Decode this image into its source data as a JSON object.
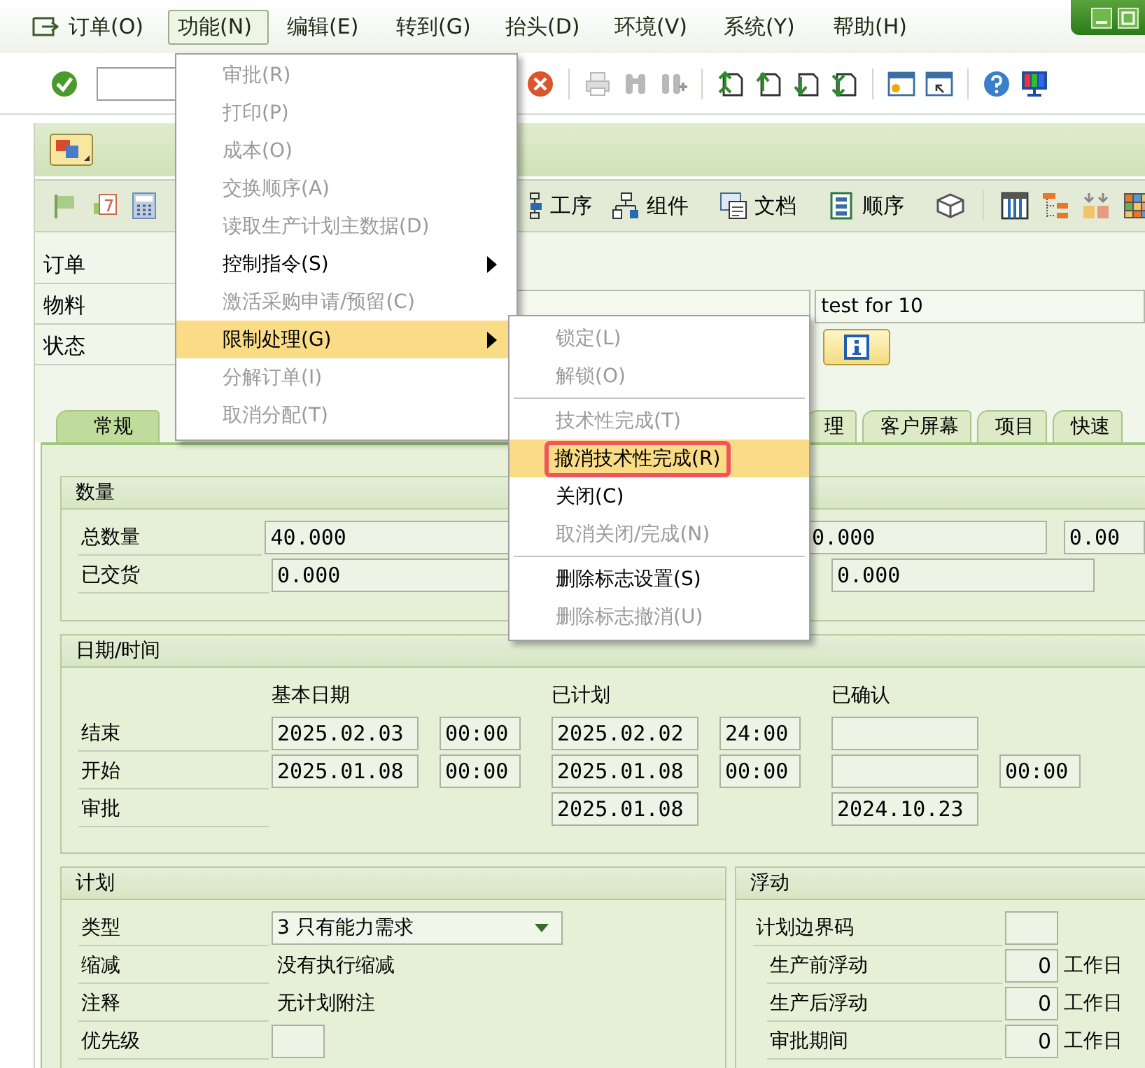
{
  "menu_bar": [
    {
      "label": "订单(O)",
      "selected": false
    },
    {
      "label": "功能(N)",
      "selected": true
    },
    {
      "label": "编辑(E)",
      "selected": false
    },
    {
      "label": "转到(G)",
      "selected": false
    },
    {
      "label": "抬头(D)",
      "selected": false
    },
    {
      "label": "环境(V)",
      "selected": false
    },
    {
      "label": "系统(Y)",
      "selected": false
    },
    {
      "label": "帮助(H)",
      "selected": false
    }
  ],
  "app_toolbar": [
    {
      "label": "工序"
    },
    {
      "label": "组件"
    },
    {
      "label": "文档"
    },
    {
      "label": "顺序"
    }
  ],
  "header": [
    {
      "label": "订单"
    },
    {
      "label": "物料",
      "description": "test for 10"
    },
    {
      "label": "状态"
    }
  ],
  "tabs": [
    {
      "label": "常规",
      "selected": true
    },
    {
      "label": "理",
      "selected": false
    },
    {
      "label": "客户屏幕",
      "selected": false
    },
    {
      "label": "项目",
      "selected": false
    },
    {
      "label": "快速",
      "selected": false
    }
  ],
  "quantities": {
    "title": "数量",
    "rows": [
      {
        "label": "总数量",
        "values": [
          "40.000",
          "0.000",
          "0.00"
        ]
      },
      {
        "label": "已交货",
        "values": [
          "0.000",
          "0.000"
        ]
      }
    ]
  },
  "dates": {
    "title": "日期/时间",
    "columns": [
      "基本日期",
      "",
      "已计划",
      "",
      "已确认"
    ],
    "rows": [
      {
        "label": "结束",
        "cells": [
          {
            "kind": "date",
            "value": "2025.02.03"
          },
          {
            "kind": "time",
            "value": "00:00"
          },
          {
            "kind": "date",
            "value": "2025.02.02"
          },
          {
            "kind": "time",
            "value": "24:00"
          },
          {
            "kind": "date"
          },
          {
            "kind": "gap"
          }
        ]
      },
      {
        "label": "开始",
        "cells": [
          {
            "kind": "date",
            "value": "2025.01.08"
          },
          {
            "kind": "time",
            "value": "00:00"
          },
          {
            "kind": "date",
            "value": "2025.01.08"
          },
          {
            "kind": "time",
            "value": "00:00"
          },
          {
            "kind": "date"
          },
          {
            "kind": "time",
            "value": "00:00"
          }
        ]
      },
      {
        "label": "审批",
        "cells": [
          {
            "kind": "gap"
          },
          {
            "kind": "gap"
          },
          {
            "kind": "date",
            "value": "2025.01.08"
          },
          {
            "kind": "gap"
          },
          {
            "kind": "date",
            "value": "2024.10.23"
          },
          {
            "kind": "gap"
          }
        ]
      }
    ]
  },
  "planning": {
    "title": "计划",
    "rows": [
      {
        "label": "类型",
        "kind": "dropdown",
        "value": "3 只有能力需求"
      },
      {
        "label": "缩减",
        "kind": "text",
        "value": "没有执行缩减"
      },
      {
        "label": "注释",
        "kind": "text",
        "value": "无计划附注"
      },
      {
        "label": "优先级",
        "kind": "field"
      }
    ]
  },
  "float": {
    "title": "浮动",
    "rows": [
      {
        "label": "计划边界码",
        "kind": "field"
      },
      {
        "label": "生产前浮动",
        "kind": "number",
        "value": "0",
        "unit": "工作日"
      },
      {
        "label": "生产后浮动",
        "kind": "number",
        "value": "0",
        "unit": "工作日"
      },
      {
        "label": "审批期间",
        "kind": "number",
        "value": "0",
        "unit": "工作日"
      }
    ]
  },
  "function_menu": [
    {
      "label": "审批(R)",
      "disabled": true,
      "selected": false,
      "submenu": false
    },
    {
      "label": "打印(P)",
      "disabled": true,
      "selected": false,
      "submenu": false
    },
    {
      "label": "成本(O)",
      "disabled": true,
      "selected": false,
      "submenu": false
    },
    {
      "label": "交换顺序(A)",
      "disabled": true,
      "selected": false,
      "submenu": false
    },
    {
      "label": "读取生产计划主数据(D)",
      "disabled": true,
      "selected": false,
      "submenu": false
    },
    {
      "label": "控制指令(S)",
      "disabled": false,
      "selected": false,
      "submenu": true
    },
    {
      "label": "激活采购申请/预留(C)",
      "disabled": true,
      "selected": false,
      "submenu": false
    },
    {
      "label": "限制处理(G)",
      "disabled": false,
      "selected": true,
      "submenu": true
    },
    {
      "label": "分解订单(I)",
      "disabled": true,
      "selected": false,
      "submenu": false
    },
    {
      "label": "取消分配(T)",
      "disabled": true,
      "selected": false,
      "submenu": false
    }
  ],
  "submenu": [
    {
      "kind": "item",
      "label": "锁定(L)",
      "disabled": true,
      "selected": false,
      "outlined": false
    },
    {
      "kind": "item",
      "label": "解锁(O)",
      "disabled": true,
      "selected": false,
      "outlined": false
    },
    {
      "kind": "separator"
    },
    {
      "kind": "item",
      "label": "技术性完成(T)",
      "disabled": true,
      "selected": false,
      "outlined": false
    },
    {
      "kind": "item",
      "label": "撤消技术性完成(R)",
      "disabled": false,
      "selected": true,
      "outlined": true
    },
    {
      "kind": "item",
      "label": "关闭(C)",
      "disabled": false,
      "selected": false,
      "outlined": false
    },
    {
      "kind": "item",
      "label": "取消关闭/完成(N)",
      "disabled": true,
      "selected": false,
      "outlined": false
    },
    {
      "kind": "separator"
    },
    {
      "kind": "item",
      "label": "删除标志设置(S)",
      "disabled": false,
      "selected": false,
      "outlined": false
    },
    {
      "kind": "item",
      "label": "删除标志撤消(U)",
      "disabled": true,
      "selected": false,
      "outlined": false
    }
  ]
}
